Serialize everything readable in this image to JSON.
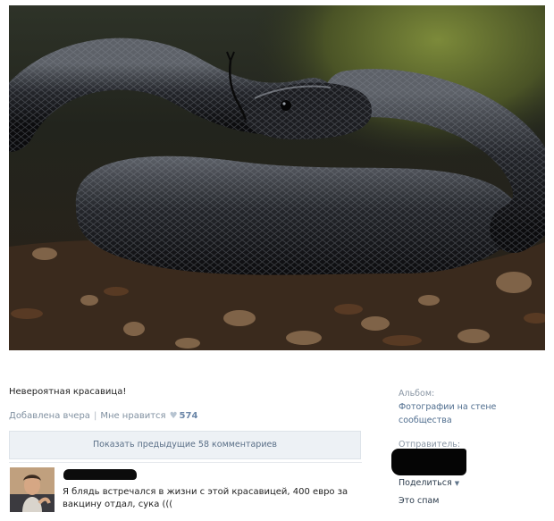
{
  "post": {
    "caption": "Невероятная красавица!",
    "added": "Добавлена вчера",
    "separator": "|",
    "like_label": "Мне нравится",
    "like_count": "574"
  },
  "comments": {
    "show_more": "Показать предыдущие 58 комментариев",
    "items": [
      {
        "text": "Я блядь встречался в жизни с этой красавицей, 400 евро за вакцину отдал, сука ((("
      }
    ]
  },
  "sidebar": {
    "album_label": "Альбом:",
    "album_link": "Фотографии на стене сообщества",
    "sender_label": "Отправитель:",
    "share": "Поделиться",
    "spam": "Это спам"
  },
  "icons": {
    "heart": "heart-icon",
    "share_caret": "caret-down-icon"
  },
  "colors": {
    "link": "#4f6d8e",
    "meta": "#8090a0",
    "button_bg": "#edf1f5"
  }
}
